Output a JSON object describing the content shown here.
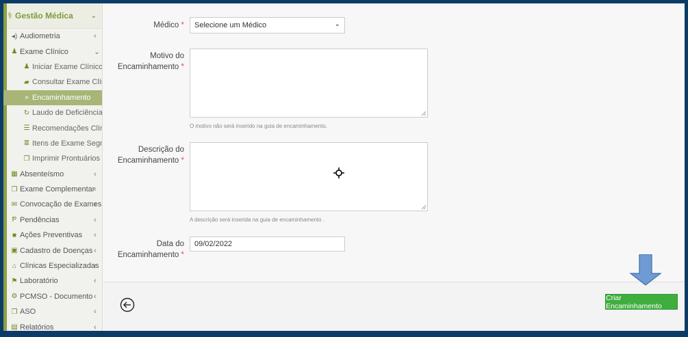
{
  "sidebar": {
    "header": {
      "icon": "stethoscope-icon",
      "title": "Gestão Médica"
    },
    "items": [
      {
        "label": "Audiometria",
        "icon": "volume-icon",
        "type": "top",
        "arrow": "‹"
      },
      {
        "label": "Exame Clínico",
        "icon": "user-icon",
        "type": "top",
        "arrow": "⌄"
      },
      {
        "label": "Iniciar Exame Clínico",
        "icon": "user-icon",
        "type": "sub"
      },
      {
        "label": "Consultar Exame Clínico",
        "icon": "book-icon",
        "type": "sub"
      },
      {
        "label": "Encaminhamento",
        "icon": "double-chevron-icon",
        "type": "sub",
        "active": true
      },
      {
        "label": "Laudo de Deficiência",
        "icon": "refresh-icon",
        "type": "sub"
      },
      {
        "label": "Recomendações Clínicas",
        "icon": "list-icon",
        "type": "sub"
      },
      {
        "label": "Itens de Exame Segmentar",
        "icon": "bars-icon",
        "type": "sub"
      },
      {
        "label": "Imprimir Prontuários",
        "icon": "copy-icon",
        "type": "sub"
      },
      {
        "label": "Absenteísmo",
        "icon": "calendar-icon",
        "type": "top",
        "arrow": "‹"
      },
      {
        "label": "Exame Complementar",
        "icon": "copy-icon",
        "type": "top",
        "arrow": "‹"
      },
      {
        "label": "Convocação de Exames",
        "icon": "envelope-icon",
        "type": "top",
        "arrow": "‹"
      },
      {
        "label": "Pendências",
        "icon": "p-icon",
        "type": "top",
        "arrow": "‹"
      },
      {
        "label": "Ações Preventivas",
        "icon": "square-icon",
        "type": "top",
        "arrow": "‹"
      },
      {
        "label": "Cadastro de Doenças",
        "icon": "briefcase-icon",
        "type": "top",
        "arrow": "‹"
      },
      {
        "label": "Clínicas Especializadas",
        "icon": "building-icon",
        "type": "top",
        "arrow": "‹"
      },
      {
        "label": "Laboratório",
        "icon": "flag-icon",
        "type": "top",
        "arrow": "‹"
      },
      {
        "label": "PCMSO - Documento",
        "icon": "gear-icon",
        "type": "top",
        "arrow": "‹"
      },
      {
        "label": "ASO",
        "icon": "copy-icon",
        "type": "top",
        "arrow": "‹"
      },
      {
        "label": "Relatórios",
        "icon": "file-icon",
        "type": "top",
        "arrow": "‹"
      }
    ]
  },
  "form": {
    "medico_label": "Médico",
    "medico_value": "Selecione um Médico",
    "motivo_label_1": "Motivo do",
    "motivo_label_2": "Encaminhamento",
    "motivo_help": "O motivo não será inserido na guia de encaminhamento.",
    "descricao_label_1": "Descrição do",
    "descricao_label_2": "Encaminhamento",
    "descricao_help": "A descrição será inserida na guia de encaminhamento .",
    "data_label_1": "Data do",
    "data_label_2": "Encaminhamento",
    "data_value": "09/02/2022",
    "required_mark": "*"
  },
  "footer": {
    "back_icon": "arrow-left-circle-icon",
    "create_label": "Criar  Encaminhamento"
  },
  "colors": {
    "frame_bg": "#0b3c68",
    "accent": "#7e9c3c",
    "active_item": "#a7b577",
    "create_button": "#3fae3f",
    "annotation_arrow": "#6f9bd4"
  }
}
